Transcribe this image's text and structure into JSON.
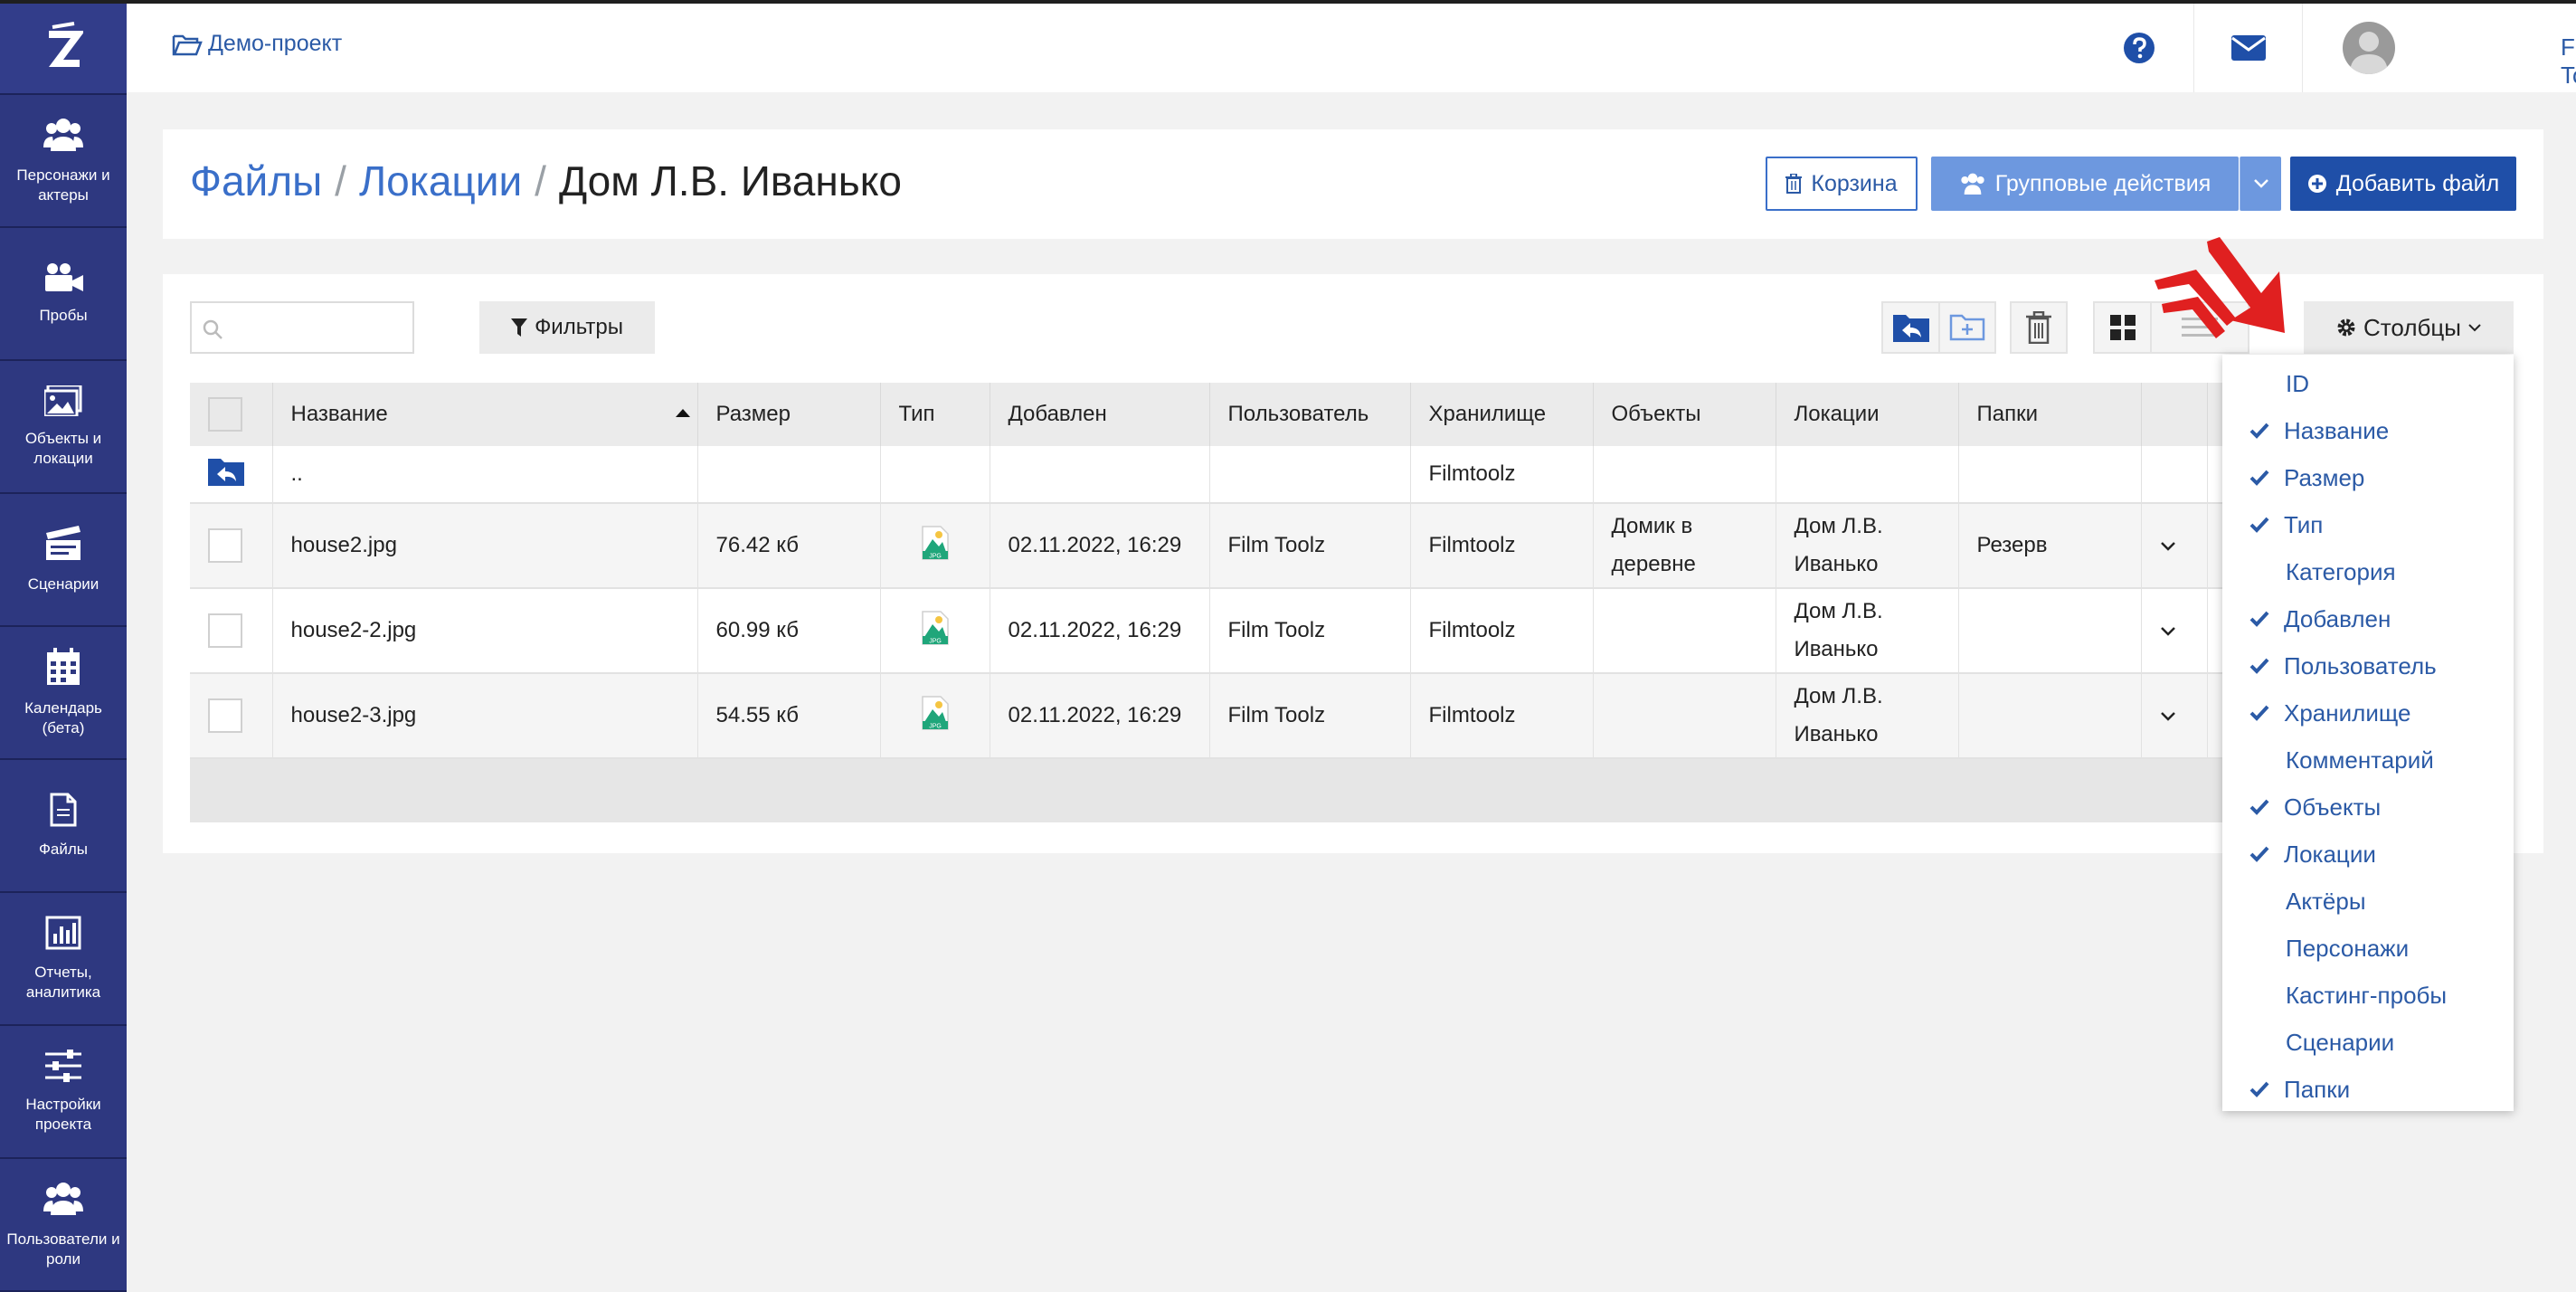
{
  "colors": {
    "sidebar": "#2b3475",
    "primary": "#1f4fa8",
    "link": "#3a6fc9",
    "accent_arrow": "#e02020"
  },
  "sidebar": {
    "items": [
      {
        "label": "Персонажи и актеры",
        "icon": "users-icon"
      },
      {
        "label": "Пробы",
        "icon": "video-camera-icon"
      },
      {
        "label": "Объекты и локации",
        "icon": "image-icon"
      },
      {
        "label": "Сценарии",
        "icon": "clapperboard-icon"
      },
      {
        "label": "Календарь (бета)",
        "icon": "calendar-icon"
      },
      {
        "label": "Файлы",
        "icon": "file-icon"
      },
      {
        "label": "Отчеты, аналитика",
        "icon": "bar-chart-icon"
      },
      {
        "label": "Настройки проекта",
        "icon": "sliders-icon"
      },
      {
        "label": "Пользователи и роли",
        "icon": "users-icon"
      }
    ]
  },
  "topbar": {
    "project": "Демо-проект",
    "user_name": "Film Toolz"
  },
  "breadcrumb": {
    "part1": "Файлы",
    "sep": "/",
    "part2": "Локации",
    "current": "Дом Л.В. Иванько"
  },
  "actions": {
    "trash": "Корзина",
    "group": "Групповые действия",
    "add": "Добавить файл"
  },
  "toolbar": {
    "search_placeholder": "",
    "filters": "Фильтры",
    "columns": "Столбцы"
  },
  "table": {
    "headers": [
      "Название",
      "Размер",
      "Тип",
      "Добавлен",
      "Пользователь",
      "Хранилище",
      "Объекты",
      "Локации",
      "Папки"
    ],
    "up_row": {
      "name": "..",
      "storage": "Filmtoolz"
    },
    "rows": [
      {
        "name": "house2.jpg",
        "size": "76.42 кб",
        "type": "JPG",
        "added": "02.11.2022, 16:29",
        "user": "Film Toolz",
        "storage": "Filmtoolz",
        "objects": "Домик в деревне",
        "locations": "Дом Л.В. Иванько",
        "folders": "Резерв"
      },
      {
        "name": "house2-2.jpg",
        "size": "60.99 кб",
        "type": "JPG",
        "added": "02.11.2022, 16:29",
        "user": "Film Toolz",
        "storage": "Filmtoolz",
        "objects": "",
        "locations": "Дом Л.В. Иванько",
        "folders": ""
      },
      {
        "name": "house2-3.jpg",
        "size": "54.55 кб",
        "type": "JPG",
        "added": "02.11.2022, 16:29",
        "user": "Film Toolz",
        "storage": "Filmtoolz",
        "objects": "",
        "locations": "Дом Л.В. Иванько",
        "folders": ""
      }
    ]
  },
  "columns_menu": [
    {
      "label": "ID",
      "checked": false
    },
    {
      "label": "Название",
      "checked": true
    },
    {
      "label": "Размер",
      "checked": true
    },
    {
      "label": "Тип",
      "checked": true
    },
    {
      "label": "Категория",
      "checked": false
    },
    {
      "label": "Добавлен",
      "checked": true
    },
    {
      "label": "Пользователь",
      "checked": true
    },
    {
      "label": "Хранилище",
      "checked": true
    },
    {
      "label": "Комментарий",
      "checked": false
    },
    {
      "label": "Объекты",
      "checked": true
    },
    {
      "label": "Локации",
      "checked": true
    },
    {
      "label": "Актёры",
      "checked": false
    },
    {
      "label": "Персонажи",
      "checked": false
    },
    {
      "label": "Кастинг-пробы",
      "checked": false
    },
    {
      "label": "Сценарии",
      "checked": false
    },
    {
      "label": "Папки",
      "checked": true
    }
  ]
}
